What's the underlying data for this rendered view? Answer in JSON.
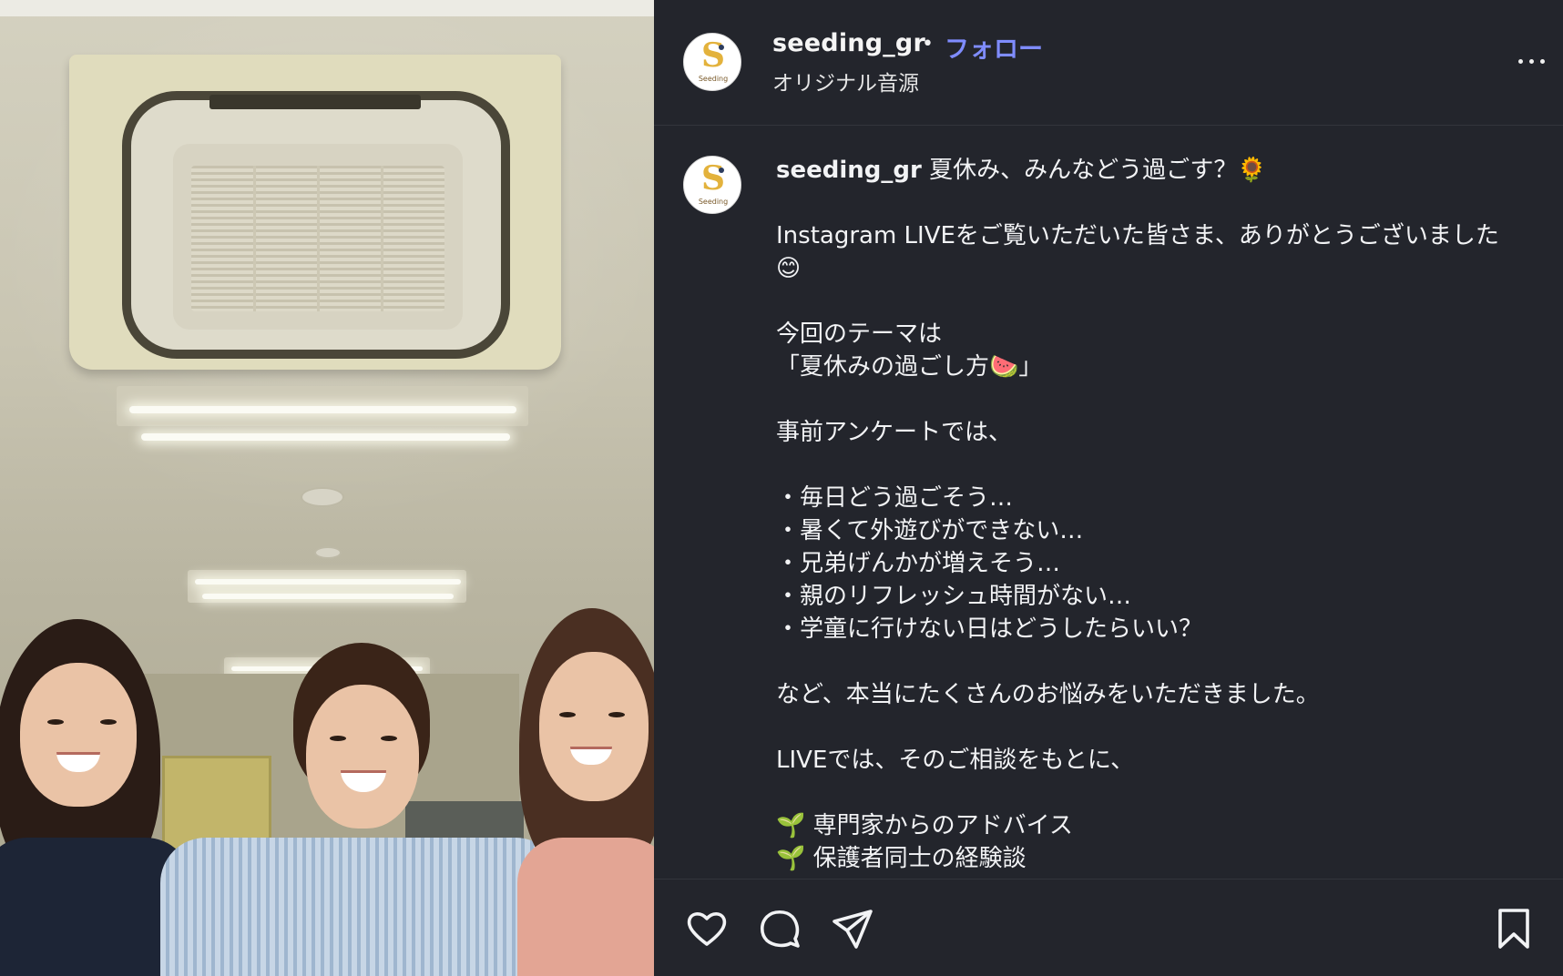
{
  "post": {
    "username": "seeding_gr",
    "separator": "•",
    "follow_label": "フォロー",
    "audio_label": "オリジナル音源",
    "avatar_letter": "S",
    "avatar_text": "Seeding"
  },
  "caption": {
    "username": "seeding_gr",
    "text": " 夏休み、みんなどう過ごす？🌻\n\nInstagram LIVEをご覧いただいた皆さま、ありがとうございました😊\n\n今回のテーマは\n「夏休みの過ごし方🍉」\n\n事前アンケートでは、\n\n・毎日どう過ごそう…\n・暑くて外遊びができない…\n・兄弟げんかが増えそう…\n・親のリフレッシュ時間がない…\n・学童に行けない日はどうしたらいい？\n\nなど、本当にたくさんのお悩みをいただきました。\n\nLIVEでは、そのご相談をもとに、\n\n🌱 専門家からのアドバイス\n🌱 保護者同士の経験談"
  },
  "icons": {
    "more": "more-horizontal-icon",
    "like": "heart-icon",
    "comment": "comment-bubble-icon",
    "share": "paper-plane-icon",
    "save": "bookmark-icon"
  },
  "colors": {
    "background": "#23252c",
    "follow": "#7f8cff",
    "text": "#f2f3f5",
    "brand_yellow": "#e3b23c"
  }
}
